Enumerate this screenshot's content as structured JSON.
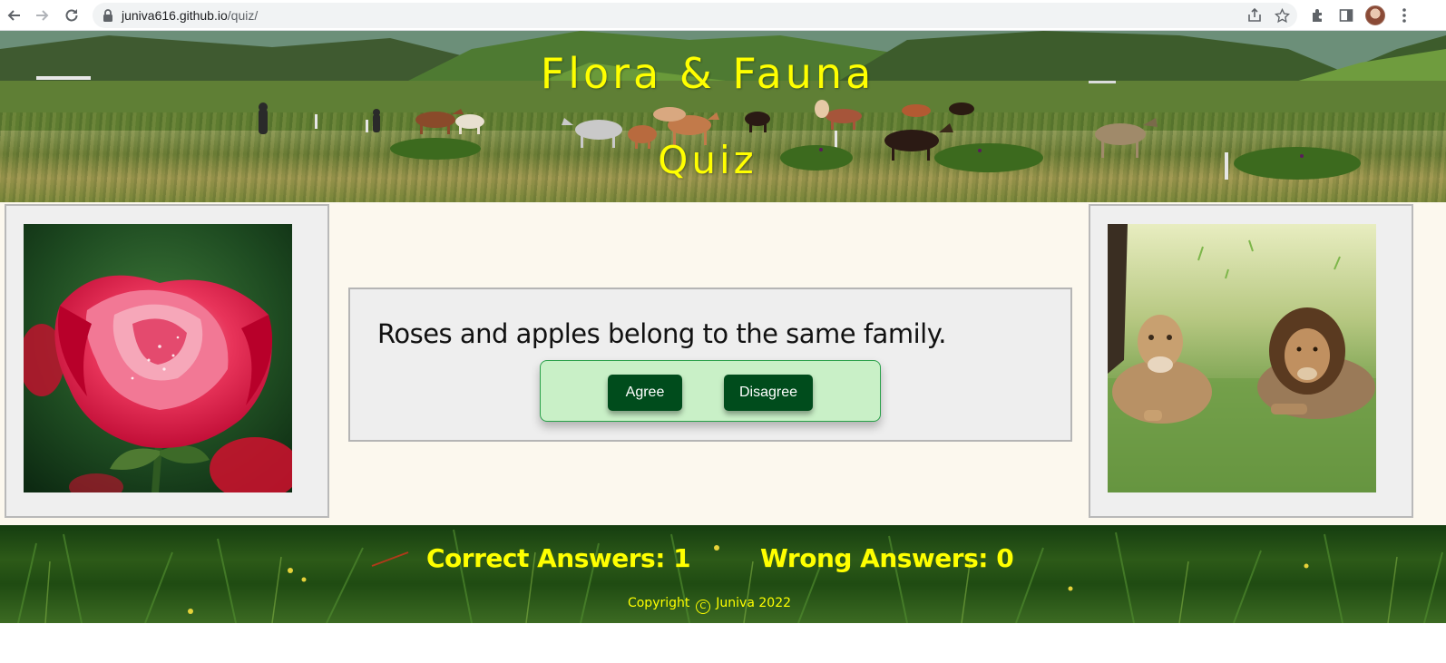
{
  "browser": {
    "url_host": "juniva616.github.io",
    "url_path": "/quiz/",
    "icons": {
      "back": "back-arrow-icon",
      "forward": "forward-arrow-icon",
      "reload": "reload-icon",
      "lock": "lock-icon",
      "share": "share-icon",
      "bookmark": "star-icon",
      "extensions": "puzzle-icon",
      "sidepanel": "side-panel-icon",
      "profile": "avatar",
      "menu": "kebab-menu-icon"
    }
  },
  "header": {
    "title": "Flora & Fauna",
    "subtitle": "Quiz",
    "title_color": "#ffff00"
  },
  "images": {
    "left": "rose-image",
    "right": "lions-image"
  },
  "quiz": {
    "question": "Roses and apples belong to the same family.",
    "agree_label": "Agree",
    "disagree_label": "Disagree",
    "button_color": "#004c1c",
    "panel_color": "#c9f0c7"
  },
  "footer": {
    "correct_label": "Correct Answers: 1",
    "wrong_label": "Wrong Answers: 0",
    "copyright_prefix": "Copyright",
    "copyright_symbol": "C",
    "copyright_suffix": "Juniva 2022"
  }
}
